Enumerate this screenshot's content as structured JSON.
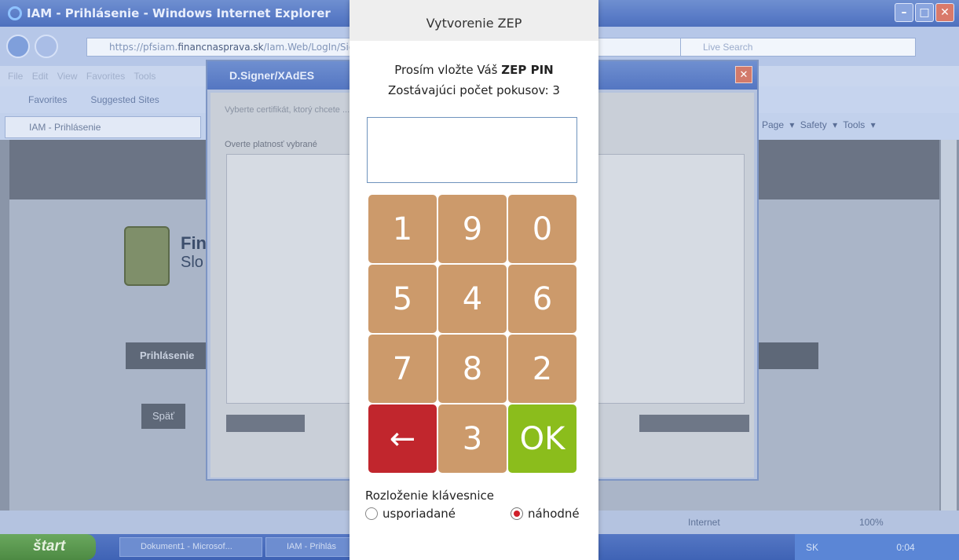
{
  "background_window": {
    "title": "IAM - Prihlásenie - Windows Internet Explorer",
    "address_prefix": "https://pfsiam.",
    "address_domain": "financnasprava.sk",
    "address_suffix": "/Iam.Web/LogIn/Sig",
    "live_search_placeholder": "Live Search",
    "menu": [
      "File",
      "Edit",
      "View",
      "Favorites",
      "Tools"
    ],
    "favorites_label": "Favorites",
    "suggested_sites_label": "Suggested Sites",
    "tab_label": "IAM - Prihlásenie",
    "command_bar": [
      "Page ▾",
      "Safety ▾",
      "Tools ▾"
    ],
    "logo_line1": "Fin",
    "logo_line2": "Slo",
    "login_button": "Prihlásenie",
    "back_button": "Späť",
    "status_zone": "Internet",
    "status_zoom": "100%",
    "taskbar_start": "štart",
    "taskbar_items": [
      "Dokument1 - Microsof...",
      "IAM - Prihlás"
    ],
    "tray_lang": "SK",
    "tray_time": "0:04"
  },
  "dsigner": {
    "title": "D.Signer/XAdES",
    "instruction": "Vyberte certifikát, ktorý chcete ... musí byť použitý",
    "verify_text": "Overte platnosť vybrané"
  },
  "modal": {
    "title": "Vytvorenie ZEP",
    "prompt_prefix": "Prosím vložte Váš ",
    "prompt_bold": "ZEP PIN",
    "attempts": "Zostávajúci počet pokusov:  3",
    "pin_value": "",
    "keys": [
      "1",
      "9",
      "0",
      "5",
      "4",
      "6",
      "7",
      "8",
      "2",
      "←",
      "3",
      "OK"
    ],
    "layout_label": "Rozloženie klávesnice",
    "option_ordered": "usporiadané",
    "option_random": "náhodné",
    "selected_option": "random",
    "colors": {
      "key_default": "#cc9a6b",
      "key_backspace": "#c1262d",
      "key_ok": "#8bbd1c",
      "radio_selected": "#d0202a"
    }
  }
}
